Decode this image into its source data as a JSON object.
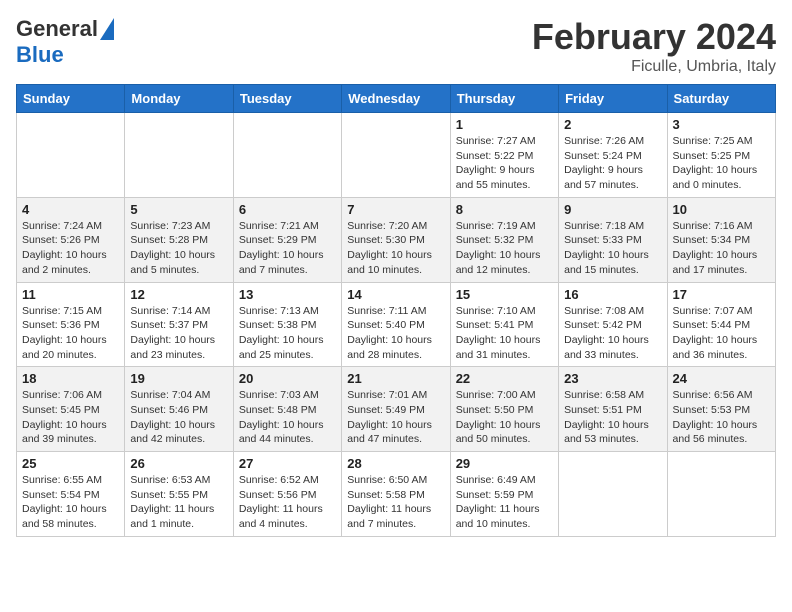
{
  "header": {
    "logo_general": "General",
    "logo_blue": "Blue",
    "month_title": "February 2024",
    "location": "Ficulle, Umbria, Italy"
  },
  "weekdays": [
    "Sunday",
    "Monday",
    "Tuesday",
    "Wednesday",
    "Thursday",
    "Friday",
    "Saturday"
  ],
  "weeks": [
    [
      {
        "day": "",
        "info": ""
      },
      {
        "day": "",
        "info": ""
      },
      {
        "day": "",
        "info": ""
      },
      {
        "day": "",
        "info": ""
      },
      {
        "day": "1",
        "info": "Sunrise: 7:27 AM\nSunset: 5:22 PM\nDaylight: 9 hours and 55 minutes."
      },
      {
        "day": "2",
        "info": "Sunrise: 7:26 AM\nSunset: 5:24 PM\nDaylight: 9 hours and 57 minutes."
      },
      {
        "day": "3",
        "info": "Sunrise: 7:25 AM\nSunset: 5:25 PM\nDaylight: 10 hours and 0 minutes."
      }
    ],
    [
      {
        "day": "4",
        "info": "Sunrise: 7:24 AM\nSunset: 5:26 PM\nDaylight: 10 hours and 2 minutes."
      },
      {
        "day": "5",
        "info": "Sunrise: 7:23 AM\nSunset: 5:28 PM\nDaylight: 10 hours and 5 minutes."
      },
      {
        "day": "6",
        "info": "Sunrise: 7:21 AM\nSunset: 5:29 PM\nDaylight: 10 hours and 7 minutes."
      },
      {
        "day": "7",
        "info": "Sunrise: 7:20 AM\nSunset: 5:30 PM\nDaylight: 10 hours and 10 minutes."
      },
      {
        "day": "8",
        "info": "Sunrise: 7:19 AM\nSunset: 5:32 PM\nDaylight: 10 hours and 12 minutes."
      },
      {
        "day": "9",
        "info": "Sunrise: 7:18 AM\nSunset: 5:33 PM\nDaylight: 10 hours and 15 minutes."
      },
      {
        "day": "10",
        "info": "Sunrise: 7:16 AM\nSunset: 5:34 PM\nDaylight: 10 hours and 17 minutes."
      }
    ],
    [
      {
        "day": "11",
        "info": "Sunrise: 7:15 AM\nSunset: 5:36 PM\nDaylight: 10 hours and 20 minutes."
      },
      {
        "day": "12",
        "info": "Sunrise: 7:14 AM\nSunset: 5:37 PM\nDaylight: 10 hours and 23 minutes."
      },
      {
        "day": "13",
        "info": "Sunrise: 7:13 AM\nSunset: 5:38 PM\nDaylight: 10 hours and 25 minutes."
      },
      {
        "day": "14",
        "info": "Sunrise: 7:11 AM\nSunset: 5:40 PM\nDaylight: 10 hours and 28 minutes."
      },
      {
        "day": "15",
        "info": "Sunrise: 7:10 AM\nSunset: 5:41 PM\nDaylight: 10 hours and 31 minutes."
      },
      {
        "day": "16",
        "info": "Sunrise: 7:08 AM\nSunset: 5:42 PM\nDaylight: 10 hours and 33 minutes."
      },
      {
        "day": "17",
        "info": "Sunrise: 7:07 AM\nSunset: 5:44 PM\nDaylight: 10 hours and 36 minutes."
      }
    ],
    [
      {
        "day": "18",
        "info": "Sunrise: 7:06 AM\nSunset: 5:45 PM\nDaylight: 10 hours and 39 minutes."
      },
      {
        "day": "19",
        "info": "Sunrise: 7:04 AM\nSunset: 5:46 PM\nDaylight: 10 hours and 42 minutes."
      },
      {
        "day": "20",
        "info": "Sunrise: 7:03 AM\nSunset: 5:48 PM\nDaylight: 10 hours and 44 minutes."
      },
      {
        "day": "21",
        "info": "Sunrise: 7:01 AM\nSunset: 5:49 PM\nDaylight: 10 hours and 47 minutes."
      },
      {
        "day": "22",
        "info": "Sunrise: 7:00 AM\nSunset: 5:50 PM\nDaylight: 10 hours and 50 minutes."
      },
      {
        "day": "23",
        "info": "Sunrise: 6:58 AM\nSunset: 5:51 PM\nDaylight: 10 hours and 53 minutes."
      },
      {
        "day": "24",
        "info": "Sunrise: 6:56 AM\nSunset: 5:53 PM\nDaylight: 10 hours and 56 minutes."
      }
    ],
    [
      {
        "day": "25",
        "info": "Sunrise: 6:55 AM\nSunset: 5:54 PM\nDaylight: 10 hours and 58 minutes."
      },
      {
        "day": "26",
        "info": "Sunrise: 6:53 AM\nSunset: 5:55 PM\nDaylight: 11 hours and 1 minute."
      },
      {
        "day": "27",
        "info": "Sunrise: 6:52 AM\nSunset: 5:56 PM\nDaylight: 11 hours and 4 minutes."
      },
      {
        "day": "28",
        "info": "Sunrise: 6:50 AM\nSunset: 5:58 PM\nDaylight: 11 hours and 7 minutes."
      },
      {
        "day": "29",
        "info": "Sunrise: 6:49 AM\nSunset: 5:59 PM\nDaylight: 11 hours and 10 minutes."
      },
      {
        "day": "",
        "info": ""
      },
      {
        "day": "",
        "info": ""
      }
    ]
  ]
}
